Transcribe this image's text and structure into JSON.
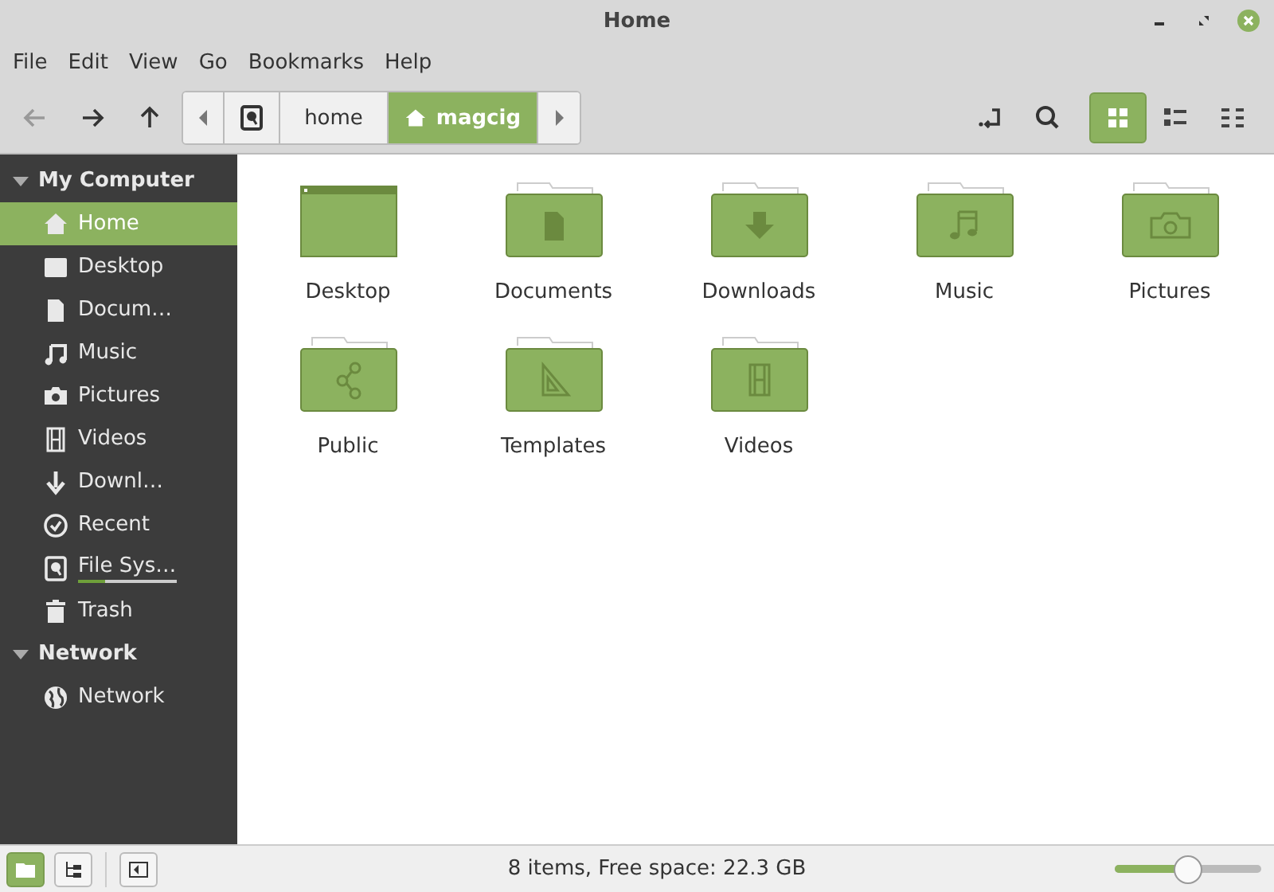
{
  "window": {
    "title": "Home"
  },
  "menu": [
    "File",
    "Edit",
    "View",
    "Go",
    "Bookmarks",
    "Help"
  ],
  "breadcrumbs": [
    {
      "kind": "drive",
      "selected": false
    },
    {
      "kind": "text",
      "label": "home",
      "selected": false
    },
    {
      "kind": "home",
      "label": "magcig",
      "selected": true
    }
  ],
  "view_modes": [
    {
      "kind": "icons",
      "selected": true
    },
    {
      "kind": "list",
      "selected": false
    },
    {
      "kind": "compact",
      "selected": false
    }
  ],
  "sidebar": [
    {
      "title": "My Computer",
      "expanded": true,
      "items": [
        {
          "kind": "home",
          "label": "Home",
          "selected": true
        },
        {
          "kind": "desktop",
          "label": "Desktop",
          "selected": false
        },
        {
          "kind": "document",
          "label": "Docum…",
          "selected": false
        },
        {
          "kind": "music",
          "label": "Music",
          "selected": false
        },
        {
          "kind": "pictures",
          "label": "Pictures",
          "selected": false
        },
        {
          "kind": "videos",
          "label": "Videos",
          "selected": false
        },
        {
          "kind": "download",
          "label": "Downl…",
          "selected": false
        },
        {
          "kind": "recent",
          "label": "Recent",
          "selected": false
        },
        {
          "kind": "drive",
          "label": "File Sys…",
          "selected": false,
          "level": 0.27
        },
        {
          "kind": "trash",
          "label": "Trash",
          "selected": false
        }
      ]
    },
    {
      "title": "Network",
      "expanded": true,
      "items": [
        {
          "kind": "network",
          "label": "Network",
          "selected": false
        }
      ]
    }
  ],
  "files": [
    {
      "kind": "desktop",
      "label": "Desktop"
    },
    {
      "kind": "document",
      "label": "Documents"
    },
    {
      "kind": "download",
      "label": "Downloads"
    },
    {
      "kind": "music",
      "label": "Music"
    },
    {
      "kind": "pictures",
      "label": "Pictures"
    },
    {
      "kind": "share",
      "label": "Public"
    },
    {
      "kind": "template",
      "label": "Templates"
    },
    {
      "kind": "videos",
      "label": "Videos"
    }
  ],
  "status_bar": {
    "sidebar_mode": [
      {
        "kind": "places",
        "selected": true
      },
      {
        "kind": "tree",
        "selected": false
      }
    ],
    "text": "8 items, Free space: 22.3 GB",
    "zoom": {
      "level": 0.5
    }
  }
}
